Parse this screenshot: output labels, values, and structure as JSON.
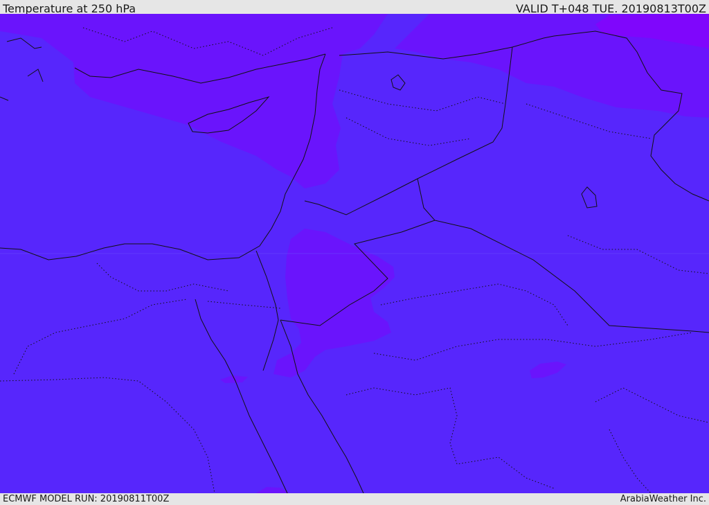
{
  "header": {
    "title": "Temperature at 250 hPa",
    "valid_time": "VALID T+048 TUE. 20190813T00Z"
  },
  "footer": {
    "model_run": "ECMWF MODEL RUN: 20190811T00Z",
    "credit": "ArabiaWeather Inc."
  },
  "map": {
    "field": "temperature",
    "level": "250 hPa",
    "colors": {
      "base_field": "#5726fc",
      "warm_field": "#6a14fc",
      "warmest_field": "#7f06fc",
      "boundary_line": "#111111"
    }
  }
}
